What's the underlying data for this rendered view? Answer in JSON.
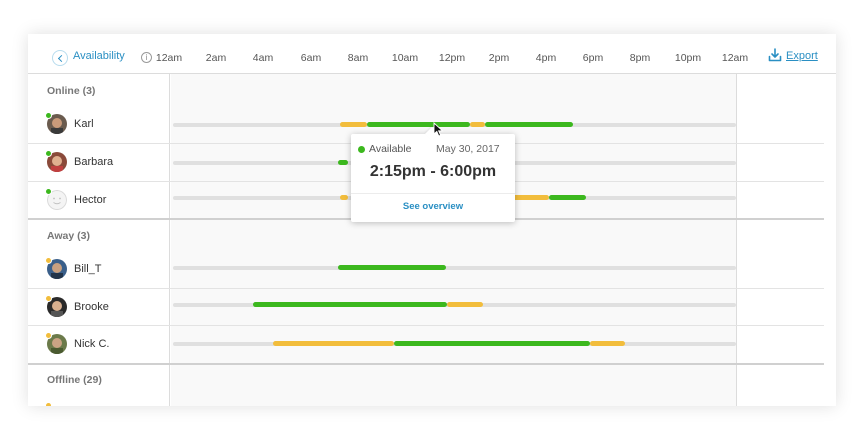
{
  "header": {
    "title": "Availability",
    "info_glyph": "i",
    "hours": [
      "12am",
      "2am",
      "4am",
      "6am",
      "8am",
      "10am",
      "12pm",
      "2pm",
      "4pm",
      "6pm",
      "8pm",
      "10pm",
      "12am"
    ],
    "export_label": "Export"
  },
  "colors": {
    "accent": "#2a8fc3",
    "available": "#3cb81e",
    "away": "#f2bd3c",
    "track": "#e0e0e0",
    "online_dot": "#3cb81e",
    "away_dot": "#f2bd3c"
  },
  "groups": {
    "online": {
      "label": "Online (3)",
      "users": [
        {
          "name": "Karl",
          "status": "online",
          "segments": [
            {
              "type": "away",
              "start": 14.5,
              "end": 16.8
            },
            {
              "type": "available",
              "start": 16.8,
              "end": 25.5
            },
            {
              "type": "away",
              "start": 25.5,
              "end": 26.8
            },
            {
              "type": "available",
              "start": 26.8,
              "end": 34.3
            }
          ]
        },
        {
          "name": "Barbara",
          "status": "online",
          "segments": [
            {
              "type": "available",
              "start": 14.3,
              "end": 15.2
            }
          ]
        },
        {
          "name": "Hector",
          "status": "online",
          "segments": [
            {
              "type": "away",
              "start": 14.5,
              "end": 15.2
            },
            {
              "type": "away",
              "start": 28.8,
              "end": 32.2
            },
            {
              "type": "available",
              "start": 32.2,
              "end": 35.4
            }
          ]
        }
      ]
    },
    "away": {
      "label": "Away (3)",
      "users": [
        {
          "name": "Bill_T",
          "status": "away",
          "segments": [
            {
              "type": "available",
              "start": 14.3,
              "end": 23.5
            }
          ]
        },
        {
          "name": "Brooke",
          "status": "away",
          "segments": [
            {
              "type": "available",
              "start": 7.1,
              "end": 23.6
            },
            {
              "type": "away",
              "start": 23.6,
              "end": 26.6
            }
          ]
        },
        {
          "name": "Nick C.",
          "status": "away",
          "segments": [
            {
              "type": "away",
              "start": 8.8,
              "end": 19.1
            },
            {
              "type": "available",
              "start": 19.1,
              "end": 35.7
            },
            {
              "type": "away",
              "start": 35.7,
              "end": 38.7
            }
          ]
        }
      ]
    },
    "offline": {
      "label": "Offline (29)"
    }
  },
  "tooltip": {
    "status": "Available",
    "date": "May 30, 2017",
    "time_range": "2:15pm - 6:00pm",
    "link_label": "See overview"
  }
}
